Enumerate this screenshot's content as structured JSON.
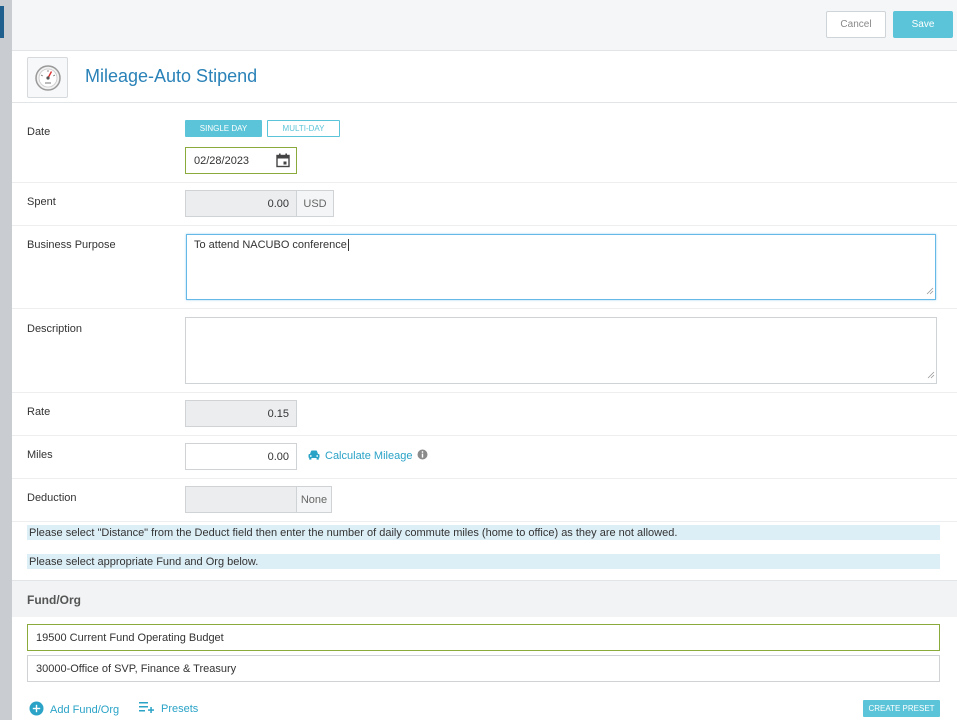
{
  "toolbar": {
    "cancel_label": "Cancel",
    "save_label": "Save"
  },
  "header": {
    "title": "Mileage-Auto Stipend",
    "icon": "speedometer-icon"
  },
  "date": {
    "label": "Date",
    "single_day_label": "SINGLE DAY",
    "multi_day_label": "MULTI-DAY",
    "selected_mode": "SINGLE DAY",
    "value": "02/28/2023"
  },
  "spent": {
    "label": "Spent",
    "value": "0.00",
    "currency": "USD"
  },
  "business_purpose": {
    "label": "Business Purpose",
    "value": "To attend NACUBO conference"
  },
  "description": {
    "label": "Description",
    "value": ""
  },
  "rate": {
    "label": "Rate",
    "value": "0.15"
  },
  "miles": {
    "label": "Miles",
    "value": "0.00",
    "calculate_label": "Calculate Mileage"
  },
  "deduction": {
    "label": "Deduction",
    "value": "",
    "selected": "None"
  },
  "notices": [
    "Please select \"Distance\" from the Deduct field then enter the number of daily commute miles (home to office) as they are not allowed.",
    "Please select appropriate Fund and Org below."
  ],
  "fund_org": {
    "title": "Fund/Org",
    "fund": "19500 Current Fund Operating Budget",
    "org": "30000-Office of SVP, Finance & Treasury",
    "add_label": "Add Fund/Org",
    "presets_label": "Presets",
    "create_preset_label": "CREATE PRESET"
  },
  "colors": {
    "accent": "#5bc4d8",
    "title_blue": "#2a82b8",
    "link": "#2aa3c7",
    "valid_border": "#8aaa3c",
    "notice_bg": "#dceef6"
  }
}
